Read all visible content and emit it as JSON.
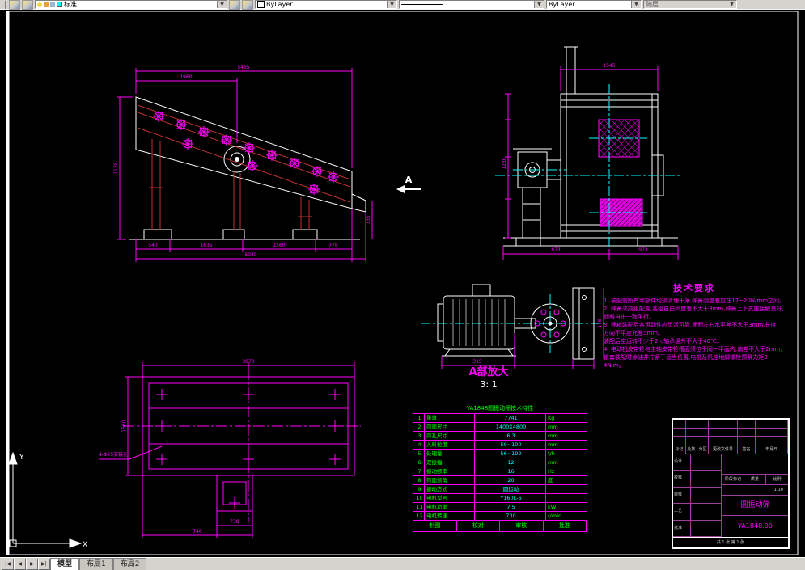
{
  "toolbar": {
    "layer_value": "标准",
    "color_value": "ByLayer",
    "lineweight_value": "ByLayer",
    "plotstyle_value": "随层"
  },
  "icons": {
    "dropdown": "▼",
    "tab_first": "|◀",
    "tab_prev": "◀",
    "tab_next": "▶",
    "tab_last": "▶|"
  },
  "layout_tabs": {
    "model": "模型",
    "layout1": "布局1",
    "layout2": "布局2"
  },
  "drawing": {
    "section_label": "A",
    "detail_title": "A部放大",
    "detail_scale": "3: 1",
    "plan_leader": "4-Φ25安装孔",
    "ucs_x": "X",
    "ucs_y": "Y",
    "dims": {
      "sv_top": "5465",
      "sv_top2": "1960",
      "sv_left": "1128",
      "sv_right": "735",
      "sv_b1": "540",
      "sv_b2": "1635",
      "sv_b3": "1560",
      "sv_b4": "778",
      "sv_overall": "5040",
      "ev_top": "1545",
      "ev_left": "1230",
      "ev_b1": "873",
      "ev_b2": "973",
      "pv_top": "3870",
      "pv_left": "1560",
      "pv_b1": "738",
      "pv_b2": "746",
      "md_b1": "315",
      "md_r1": "176"
    }
  },
  "tech_req": {
    "title": "技术要求",
    "lines": [
      "1. 装配前所有零部件均须清理干净,弹簧刚度差应在17~20N/mm之间。",
      "2. 弹簧须成组配置,各组自由高度差不大于3mm,弹簧上下支座接触良好,",
      "   倾斜自由一致平行。",
      "3. 筛箱装配后各运动件应灵活可靠,筛面左右水平差不大于3mm,长度",
      "   方向不平度允差5mm。",
      "   装配后空运转不少于2h,轴承温升不大于40℃。",
      "4. 电动机皮带轮与主轴皮带轮槽面须位于同一平面内,偏差不大于2mm,",
      "   锥套装配时涂油并拧紧于适当位置,电机及机座地脚螺栓预紧力矩3~",
      "   4N·m。"
    ]
  },
  "param_table": {
    "title": "YA1848圆振动筛技术特性",
    "rows": [
      {
        "no": "1",
        "label": "重量",
        "value": "7741",
        "unit": "Kg"
      },
      {
        "no": "2",
        "label": "筛面尺寸",
        "value": "1400X4800",
        "unit": "mm"
      },
      {
        "no": "3",
        "label": "筛孔尺寸",
        "value": "6.3",
        "unit": "mm"
      },
      {
        "no": "4",
        "label": "入料粒度",
        "value": "50~100",
        "unit": "mm"
      },
      {
        "no": "5",
        "label": "处理量",
        "value": "56~192",
        "unit": "t/h"
      },
      {
        "no": "6",
        "label": "双振幅",
        "value": "12",
        "unit": "mm"
      },
      {
        "no": "7",
        "label": "振动频率",
        "value": "16",
        "unit": "Hz"
      },
      {
        "no": "8",
        "label": "筛面倾角",
        "value": "20",
        "unit": "度"
      },
      {
        "no": "9",
        "label": "振动方式",
        "value": "圆运动",
        "unit": ""
      },
      {
        "no": "10",
        "label": "电机型号",
        "value": "Y160L-6",
        "unit": ""
      },
      {
        "no": "11",
        "label": "电机功率",
        "value": "7.5",
        "unit": "kW"
      },
      {
        "no": "12",
        "label": "电机转速",
        "value": "730",
        "unit": "r/min"
      }
    ],
    "footer": [
      "制图",
      "校对",
      "审核",
      "批准"
    ]
  },
  "title_block": {
    "rev_headers": [
      "标记",
      "处数",
      "分区",
      "更改文件号",
      "签名",
      "年月日"
    ],
    "roles": [
      "设计",
      "校核",
      "审核",
      "工艺",
      "批准"
    ],
    "stage_labels": [
      "阶段标记",
      "质量",
      "比例"
    ],
    "scale": "1:10",
    "name": "圆振动筛",
    "dwg_no": "YA1848.00",
    "sheet": "共 1 张  第 1 张"
  }
}
